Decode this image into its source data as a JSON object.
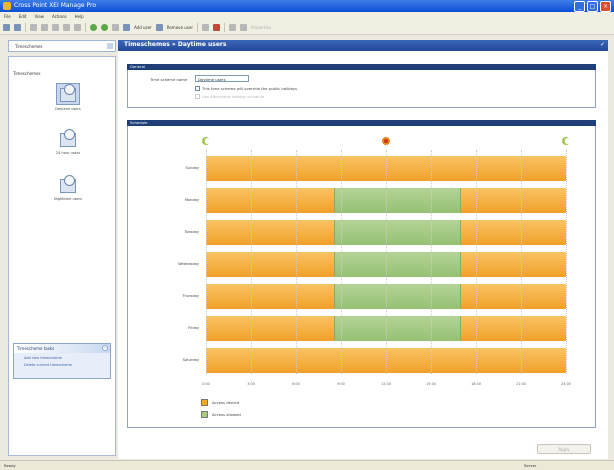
{
  "window": {
    "title": "Cross Point XEI Manage Pro",
    "title_bar_color": "#0d4fd6"
  },
  "menu": [
    "File",
    "Edit",
    "View",
    "Actions",
    "Help"
  ],
  "toolbar": {
    "add_label": "Add user",
    "remove_label": "Remove user",
    "properties_label": "Properties"
  },
  "left": {
    "selector_value": "Timeschemes",
    "tree_header": "Timeschemes",
    "items": [
      {
        "label": "Daytime users",
        "selected": true
      },
      {
        "label": "24 hour users",
        "selected": false
      },
      {
        "label": "Nighttime users",
        "selected": false
      }
    ],
    "tasks": {
      "title": "Timescheme tasks",
      "links": [
        "Add new timescheme",
        "Delete current timescheme"
      ]
    }
  },
  "main": {
    "header_title": "Timeschemes » Daytime users",
    "general": {
      "title": "General",
      "name_label": "Time scheme name",
      "name_value": "Daytime users",
      "override_label": "This time scheme will override the public holidays",
      "alternative_label": "Use alternative holiday schedule"
    },
    "schedule": {
      "title": "Schedule",
      "days": [
        {
          "label": "Sunday",
          "allowed": []
        },
        {
          "label": "Monday",
          "allowed": [
            [
              8.5,
              17
            ]
          ]
        },
        {
          "label": "Tuesday",
          "allowed": [
            [
              8.5,
              17
            ]
          ]
        },
        {
          "label": "Wednesday",
          "allowed": [
            [
              8.5,
              17
            ]
          ]
        },
        {
          "label": "Thursday",
          "allowed": [
            [
              8.5,
              17
            ]
          ]
        },
        {
          "label": "Friday",
          "allowed": [
            [
              8.5,
              17
            ]
          ]
        },
        {
          "label": "Saturday",
          "allowed": []
        }
      ],
      "ticks": [
        "0:00",
        "3:00",
        "6:00",
        "9:00",
        "12:00",
        "15:00",
        "18:00",
        "21:00",
        "24:00"
      ],
      "legend": {
        "denied": "Access denied",
        "allowed": "Access allowed"
      },
      "colors": {
        "denied": "#f3a52d",
        "allowed": "#a6cb83"
      }
    },
    "apply_label": "Apply"
  },
  "status": {
    "left": "Ready",
    "right": "Server"
  }
}
